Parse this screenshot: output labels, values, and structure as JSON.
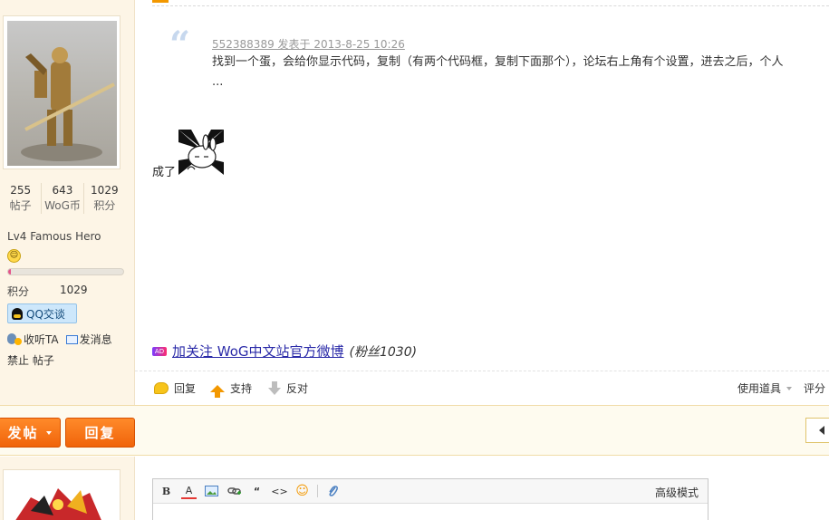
{
  "profile": {
    "stats": [
      {
        "value": "255",
        "label": "帖子"
      },
      {
        "value": "643",
        "label": "WoG币"
      },
      {
        "value": "1029",
        "label": "积分"
      }
    ],
    "rank": "Lv4 Famous Hero",
    "level_progress": 0.02,
    "points_label": "积分",
    "points_value": "1029",
    "qq_button": "QQ交谈",
    "follow": "收听TA",
    "message": "发消息",
    "ban_posts": "禁止 帖子"
  },
  "post": {
    "quote_author": "552388389 发表于 2013-8-25 10:26",
    "quote_text": "找到一个蛋，会给你显示代码，复制（有两个代码框，复制下面那个），论坛右上角有个设置，进去之后，个人 ...",
    "reply_text": "成了",
    "signature_link": "加关注 WoG中文站官方微博",
    "signature_fans": "(粉丝1030)",
    "ad_badge": "AD"
  },
  "post_actions": {
    "reply": "回复",
    "support": "支持",
    "oppose": "反对",
    "use_item": "使用道具",
    "rate": "评分"
  },
  "toolbar": {
    "new_post": "发帖",
    "reply": "回复"
  },
  "editor": {
    "advanced_mode": "高级模式",
    "buttons": [
      "B",
      "A",
      "🖼",
      "🔗",
      "“",
      "<>",
      "☺",
      "📎"
    ]
  },
  "colors": {
    "accent": "#f39800",
    "button_orange": "#f0640a",
    "sidebar_bg": "#fdf5e6",
    "link": "#2a2aa8"
  }
}
